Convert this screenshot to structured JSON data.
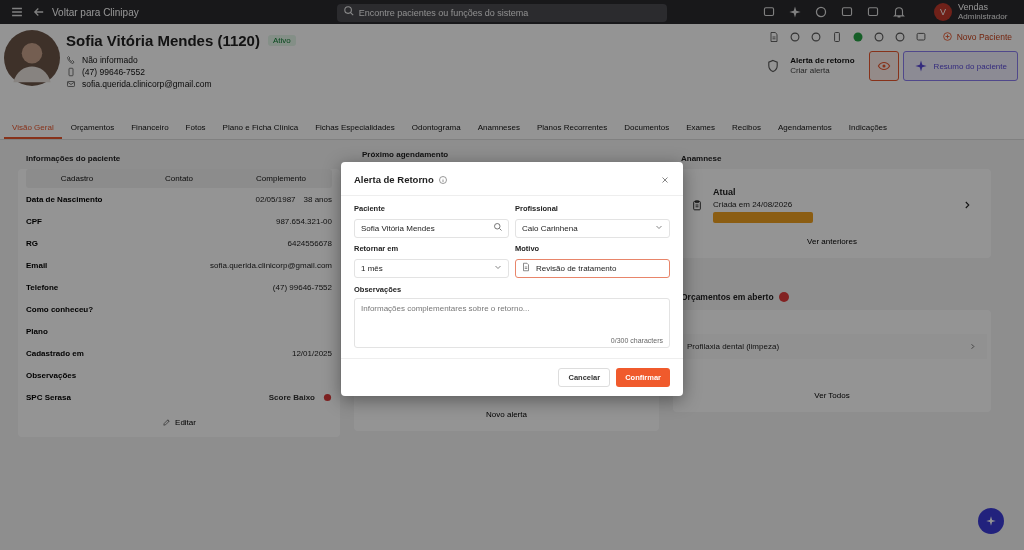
{
  "topbar": {
    "back_link": "Voltar para Clinipay",
    "search": {
      "placeholder": "Encontre pacientes ou funções do sistema"
    },
    "user": {
      "initial": "V",
      "name": "Vendas",
      "role": "Administrador"
    }
  },
  "patient": {
    "name": "Sofia Vitória Mendes (1120)",
    "status": "Ativo",
    "phone_note": "Não informado",
    "phone": "(47) 99646-7552",
    "email": "sofia.querida.clinicorp@gmail.com"
  },
  "header_actions": {
    "new_patient": "Novo Paciente",
    "return_alert": {
      "title": "Alerta de retorno",
      "subtitle": "Criar alerta"
    },
    "summary": "Resumo do paciente"
  },
  "tabs": [
    {
      "label": "Visão Geral",
      "selected": true
    },
    {
      "label": "Orçamentos",
      "selected": false
    },
    {
      "label": "Financeiro",
      "selected": false
    },
    {
      "label": "Fotos",
      "selected": false
    },
    {
      "label": "Plano e Ficha Clínica",
      "selected": false
    },
    {
      "label": "Fichas Especialidades",
      "selected": false
    },
    {
      "label": "Odontograma",
      "selected": false
    },
    {
      "label": "Anamneses",
      "selected": false
    },
    {
      "label": "Planos Recorrentes",
      "selected": false
    },
    {
      "label": "Documentos",
      "selected": false
    },
    {
      "label": "Exames",
      "selected": false
    },
    {
      "label": "Recibos",
      "selected": false
    },
    {
      "label": "Agendamentos",
      "selected": false
    },
    {
      "label": "Indicações",
      "selected": false
    }
  ],
  "info_card": {
    "title": "Informações do paciente",
    "subtabs": [
      "Cadastro",
      "Contato",
      "Complemento"
    ],
    "rows": [
      {
        "kind": "text",
        "label": "Data de Nascimento",
        "value": "02/05/1987",
        "extra": "38 anos"
      },
      {
        "kind": "text",
        "label": "CPF",
        "value": "987.654.321-00"
      },
      {
        "kind": "text",
        "label": "RG",
        "value": "6424556678"
      },
      {
        "kind": "text",
        "label": "Email",
        "value": "sofia.querida.clinicorp@gmail.com"
      },
      {
        "kind": "text",
        "label": "Telefone",
        "value": "(47) 99646-7552"
      },
      {
        "kind": "text",
        "label": "Como conheceu?"
      },
      {
        "kind": "text",
        "label": "Plano"
      },
      {
        "kind": "text",
        "label": "Cadastrado em",
        "value": "12/01/2025"
      },
      {
        "kind": "text",
        "label": "Observações"
      },
      {
        "kind": "score",
        "label": "SPC Serasa",
        "value": "Score Baixo"
      }
    ],
    "edit": "Editar"
  },
  "appointment_card": {
    "title": "Próximo agendamento",
    "button": "Novo alerta"
  },
  "anamnese_card": {
    "title": "Anamnese",
    "item": {
      "title": "Atual",
      "date": "Criada em 24/08/2026"
    },
    "more": "Ver anteriores"
  },
  "budgets_card": {
    "title": "Orçamentos em aberto",
    "items": [
      "Profilaxia dental (limpeza)"
    ],
    "more": "Ver Todos"
  },
  "modal": {
    "title": "Alerta de Retorno",
    "fields": [
      {
        "kind": "search",
        "label": "Paciente",
        "value": "Sofia Vitória Mendes",
        "focused": false
      },
      {
        "kind": "select",
        "label": "Profissional",
        "value": "Caio Carinhena",
        "focused": false
      },
      {
        "kind": "select",
        "label": "Retornar em",
        "value": "1 mês",
        "focused": false
      },
      {
        "kind": "text",
        "label": "Motivo",
        "value": "Revisão de tratamento",
        "focused": true
      }
    ],
    "notes": {
      "label": "Observações",
      "placeholder": "Informações complementares sobre o retorno...",
      "counter": "0/300 characters"
    },
    "cancel": "Cancelar",
    "confirm": "Confirmar"
  }
}
